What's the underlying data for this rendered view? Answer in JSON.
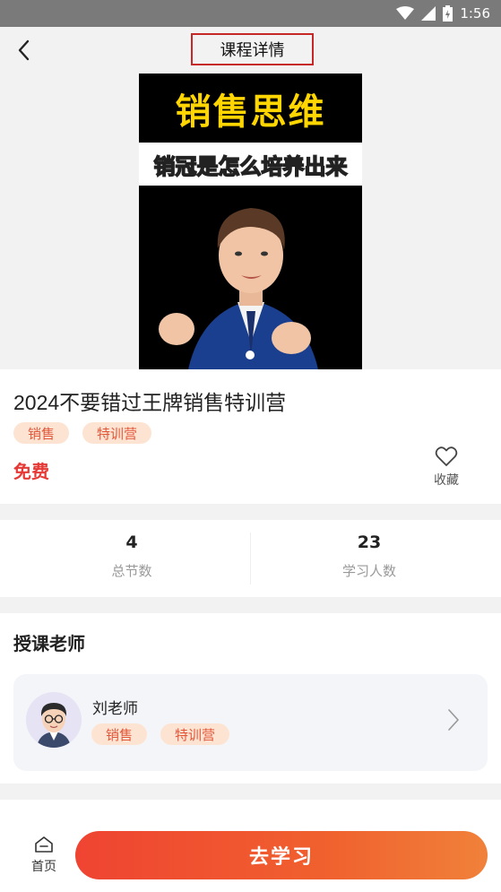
{
  "status_bar": {
    "time": "1:56"
  },
  "header": {
    "title": "课程详情"
  },
  "hero": {
    "title": "销售思维",
    "subtitle": "销冠是怎么培养出来"
  },
  "course": {
    "title": "2024不要错过王牌销售特训营",
    "tags": [
      "销售",
      "特训营"
    ],
    "price": "免费",
    "favorite_label": "收藏"
  },
  "stats": [
    {
      "value": "4",
      "label": "总节数"
    },
    {
      "value": "23",
      "label": "学习人数"
    }
  ],
  "teacher_section": {
    "title": "授课老师",
    "teacher": {
      "name": "刘老师",
      "tags": [
        "销售",
        "特训营"
      ]
    }
  },
  "bottom_bar": {
    "home_label": "首页",
    "study_label": "去学习"
  },
  "colors": {
    "accent": "#ef4432",
    "price": "#e53935",
    "tag_bg": "#fde4d2",
    "tag_text": "#e2573a",
    "hero_yellow": "#ffd600",
    "outline_red": "#c62828"
  },
  "icons": {
    "back": "chevron-left-icon",
    "favorite": "heart-outline-icon",
    "home": "home-icon",
    "teacher_nav": "chevron-right-icon",
    "wifi": "wifi-icon",
    "signal": "signal-icon",
    "battery": "battery-icon"
  }
}
